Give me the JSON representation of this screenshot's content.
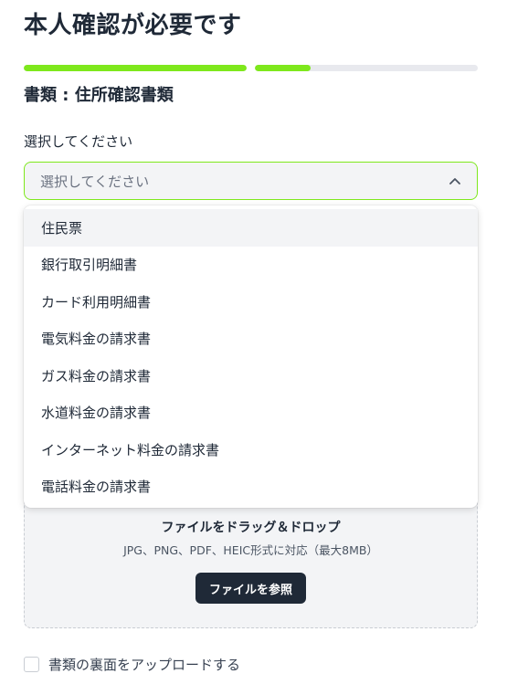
{
  "header": {
    "title": "本人確認が必要です"
  },
  "progress": {
    "steps": [
      {
        "fill": 1.0
      },
      {
        "fill": 0.25
      }
    ],
    "active_color": "#7ee81c",
    "track_color": "#e8e9ee"
  },
  "document": {
    "type_label": "書類 : 住所確認書類"
  },
  "select": {
    "label": "選択してください",
    "placeholder": "選択してください",
    "is_open": true,
    "highlighted_index": 0,
    "options": [
      "住民票",
      "銀行取引明細書",
      "カード利用明細書",
      "電気料金の請求書",
      "ガス料金の請求書",
      "水道料金の請求書",
      "インターネット料金の請求書",
      "電話料金の請求書"
    ]
  },
  "upload": {
    "title": "ファイルをドラッグ＆ドロップ",
    "subtitle": "JPG、PNG、PDF、HEIC形式に対応（最大8MB）",
    "browse_label": "ファイルを参照"
  },
  "back_side": {
    "label": "書類の裏面をアップロードする",
    "checked": false
  },
  "icons": {
    "select_toggle": "chevron-up-icon"
  }
}
